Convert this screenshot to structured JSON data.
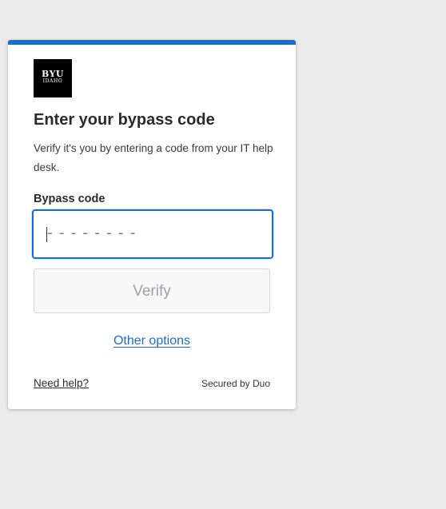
{
  "brand": {
    "logo_line1": "BYU",
    "logo_line2": "IDAHO",
    "accent_color": "#1a6ec6"
  },
  "prompt": {
    "title": "Enter your bypass code",
    "description": "Verify it's you by entering a code from your IT help desk."
  },
  "bypass_field": {
    "label": "Bypass code",
    "value": "",
    "placeholder": "--------"
  },
  "verify_button": {
    "label": "Verify",
    "state": "disabled"
  },
  "links": {
    "other_options": "Other options",
    "need_help": "Need help?"
  },
  "footer": {
    "secured_by": "Secured by Duo"
  }
}
